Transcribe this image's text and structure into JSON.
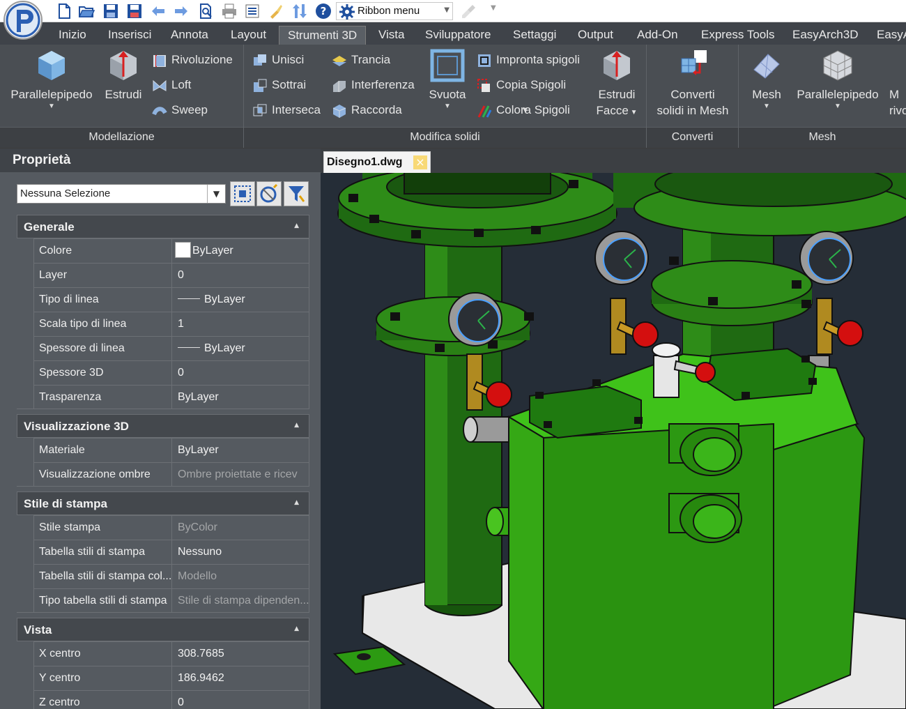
{
  "quick_access": {
    "menu_label": "Ribbon menu",
    "icons": [
      "new-icon",
      "open-icon",
      "save-icon",
      "save-as-icon",
      "undo-icon",
      "redo-icon",
      "print-preview-icon",
      "print-icon",
      "properties-icon",
      "match-properties-icon",
      "sort-icon",
      "help-icon",
      "gear-icon"
    ]
  },
  "ribbon_tabs": [
    "Inizio",
    "Inserisci",
    "Annota",
    "Layout",
    "Strumenti 3D",
    "Vista",
    "Sviluppatore",
    "Settaggi",
    "Output",
    "Add-On",
    "Express Tools",
    "EasyArch3D",
    "EasyA"
  ],
  "active_tab": "Strumenti 3D",
  "panels": {
    "modellazione": {
      "title": "Modellazione",
      "box_line1": "Parallelepipedo",
      "extrude": "Estrudi",
      "small": [
        "Rivoluzione",
        "Loft",
        "Sweep"
      ]
    },
    "modifica": {
      "title": "Modifica solidi",
      "col1": [
        "Unisci",
        "Sottrai",
        "Interseca"
      ],
      "col2": [
        "Trancia",
        "Interferenza",
        "Raccorda"
      ],
      "shell": "Svuota",
      "col3": [
        "Impronta spigoli",
        "Copia Spigoli",
        "Colora Spigoli"
      ],
      "extrude_faces_1": "Estrudi",
      "extrude_faces_2": "Facce"
    },
    "converti": {
      "title": "Converti",
      "line1": "Converti",
      "line2": "solidi in Mesh"
    },
    "mesh": {
      "title": "Mesh",
      "mesh": "Mesh",
      "box": "Parallelepipedo",
      "cut1": "M",
      "cut2": "rivo"
    }
  },
  "properties": {
    "title": "Proprietà",
    "selection": "Nessuna Selezione",
    "sections": {
      "generale": {
        "label": "Generale",
        "rows": [
          {
            "name": "Colore",
            "value": "ByLayer"
          },
          {
            "name": "Layer",
            "value": "0"
          },
          {
            "name": "Tipo di linea",
            "value": "ByLayer"
          },
          {
            "name": "Scala tipo di linea",
            "value": "1"
          },
          {
            "name": "Spessore di linea",
            "value": "ByLayer"
          },
          {
            "name": "Spessore 3D",
            "value": "0"
          },
          {
            "name": "Trasparenza",
            "value": "ByLayer"
          }
        ]
      },
      "vis3d": {
        "label": "Visualizzazione 3D",
        "rows": [
          {
            "name": "Materiale",
            "value": "ByLayer"
          },
          {
            "name": "Visualizzazione ombre",
            "value": "Ombre proiettate e ricev"
          }
        ]
      },
      "stile": {
        "label": "Stile di stampa",
        "rows": [
          {
            "name": "Stile stampa",
            "value": "ByColor"
          },
          {
            "name": "Tabella stili di stampa",
            "value": "Nessuno"
          },
          {
            "name": "Tabella stili di stampa col...",
            "value": "Modello"
          },
          {
            "name": "Tipo tabella stili di stampa",
            "value": "Stile di stampa dipenden..."
          }
        ]
      },
      "vista": {
        "label": "Vista",
        "rows": [
          {
            "name": "X centro",
            "value": "308.7685"
          },
          {
            "name": "Y centro",
            "value": "186.9462"
          },
          {
            "name": "Z centro",
            "value": "0"
          }
        ]
      }
    }
  },
  "document": {
    "tab_label": "Disegno1.dwg"
  },
  "colors": {
    "accent_green": "#2f8a12",
    "dark_green": "#1f5e12",
    "gauge_red": "#d40f0f",
    "viewport_bg": "#252d37"
  }
}
